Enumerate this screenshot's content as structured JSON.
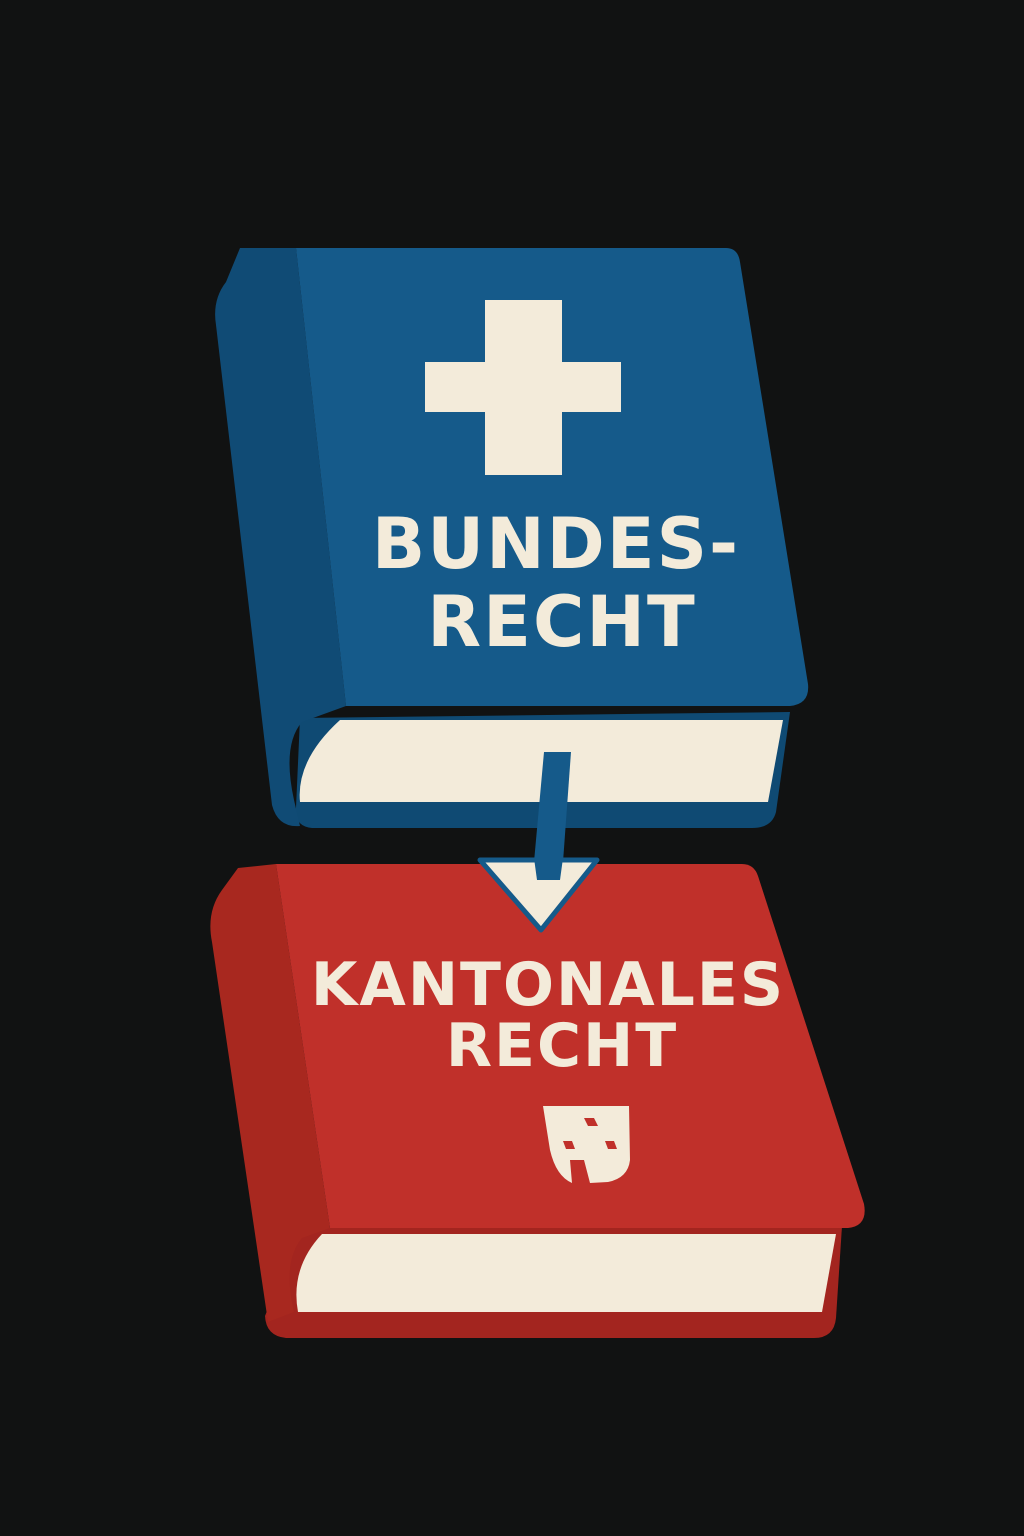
{
  "colors": {
    "background": "#111212",
    "federal_blue": "#155a8a",
    "federal_blue_dark": "#0f4a73",
    "cantonal_red": "#c0302a",
    "cantonal_red_dark": "#a3251f",
    "paper_cream": "#f3ebda"
  },
  "federal_book": {
    "title_line1": "BUNDES-",
    "title_line2": "RECHT",
    "emblem": "swiss-cross-icon"
  },
  "arrow": {
    "direction": "down",
    "icon": "arrow-down-icon"
  },
  "cantonal_book": {
    "title_line1": "KANTONALES",
    "title_line2": "RECHT",
    "emblem": "coat-of-arms-shield-icon"
  }
}
